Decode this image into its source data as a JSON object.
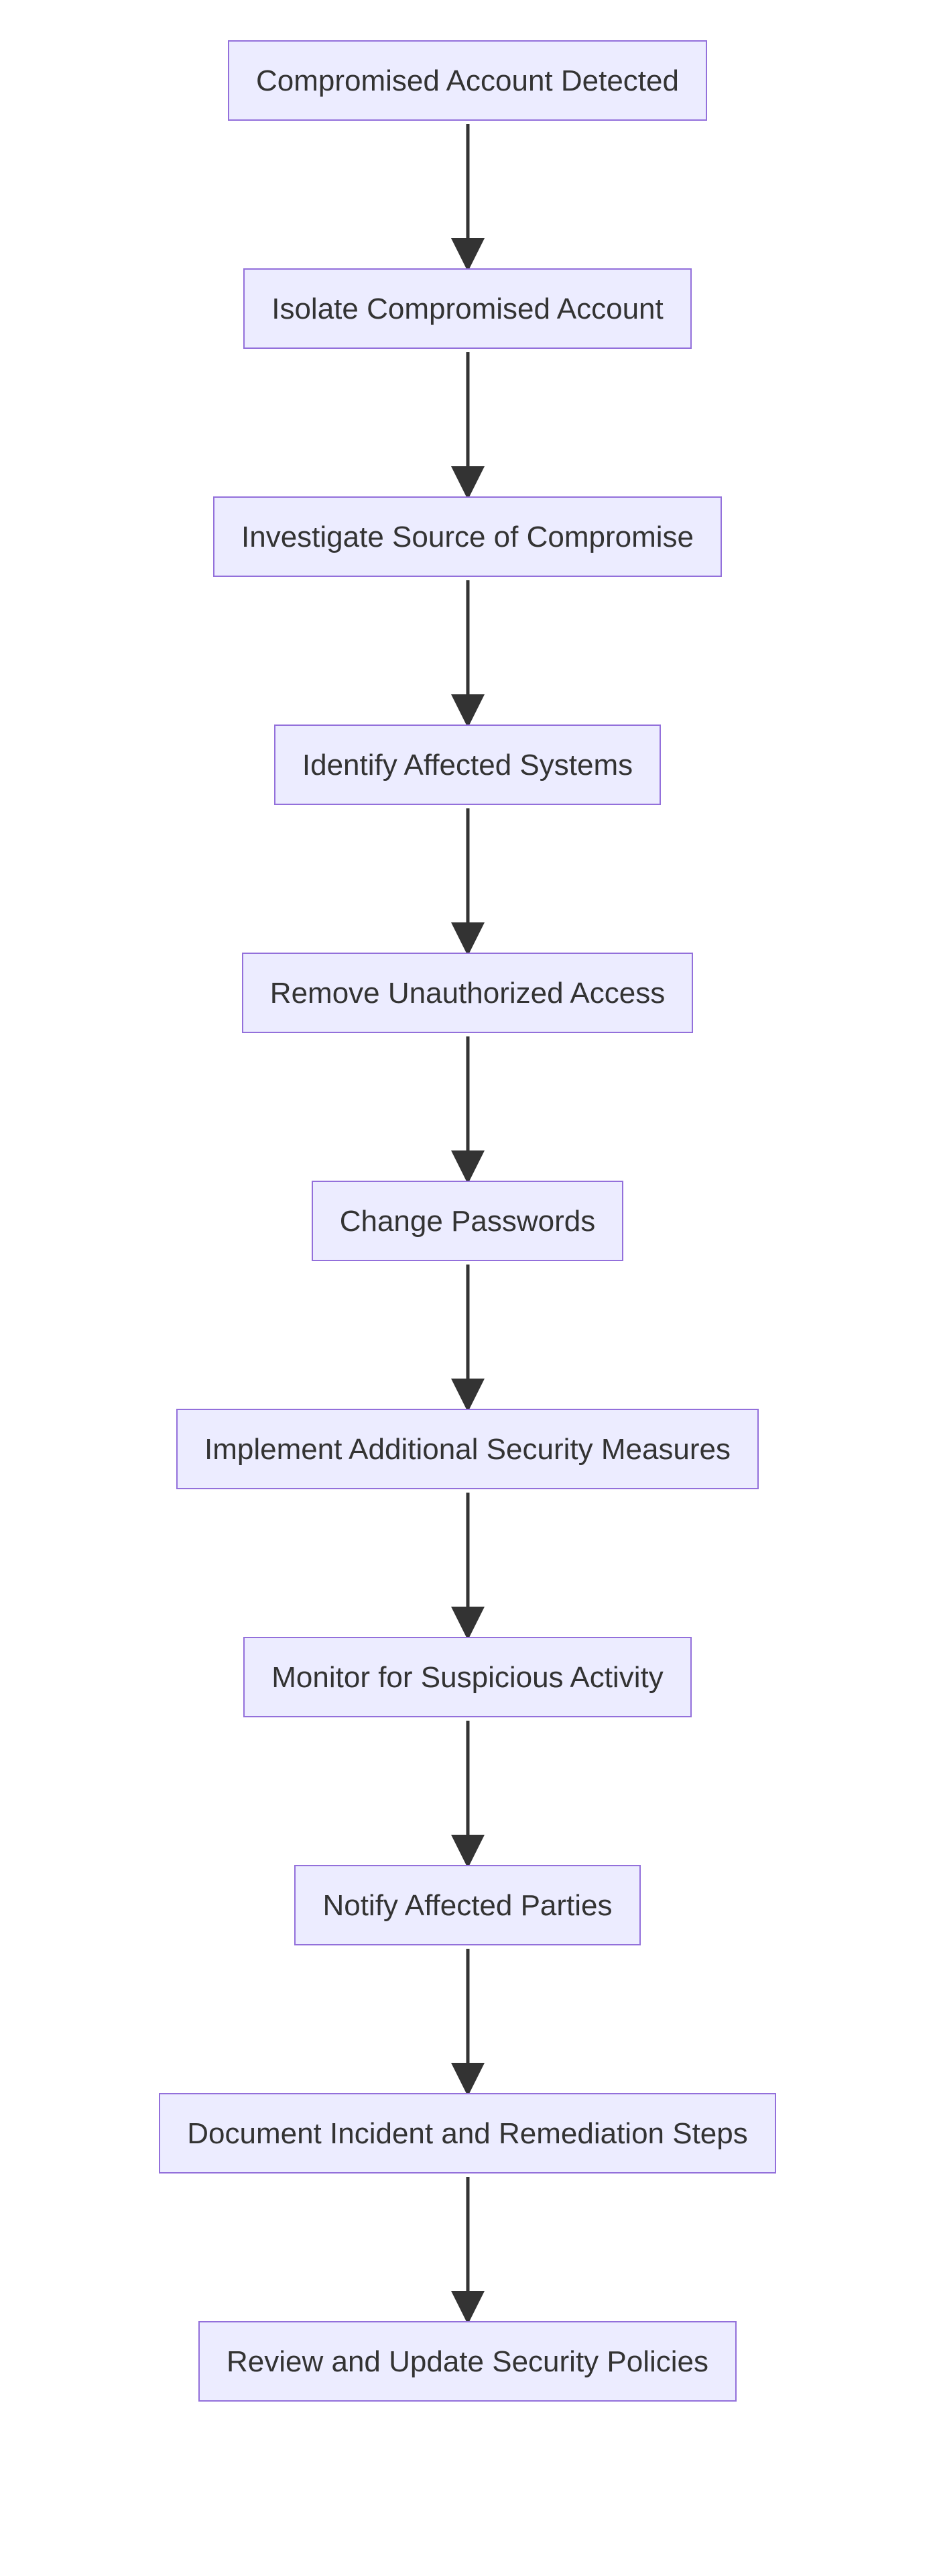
{
  "chart_data": {
    "type": "flowchart",
    "direction": "TD",
    "nodes": [
      {
        "id": "A",
        "label": "Compromised Account Detected"
      },
      {
        "id": "B",
        "label": "Isolate Compromised Account"
      },
      {
        "id": "C",
        "label": "Investigate Source of Compromise"
      },
      {
        "id": "D",
        "label": "Identify Affected Systems"
      },
      {
        "id": "E",
        "label": "Remove Unauthorized Access"
      },
      {
        "id": "F",
        "label": "Change Passwords"
      },
      {
        "id": "G",
        "label": "Implement Additional Security Measures"
      },
      {
        "id": "H",
        "label": "Monitor for Suspicious Activity"
      },
      {
        "id": "I",
        "label": "Notify Affected Parties"
      },
      {
        "id": "J",
        "label": "Document Incident and Remediation Steps"
      },
      {
        "id": "K",
        "label": "Review and Update Security Policies"
      }
    ],
    "edges": [
      {
        "from": "A",
        "to": "B"
      },
      {
        "from": "B",
        "to": "C"
      },
      {
        "from": "C",
        "to": "D"
      },
      {
        "from": "D",
        "to": "E"
      },
      {
        "from": "E",
        "to": "F"
      },
      {
        "from": "F",
        "to": "G"
      },
      {
        "from": "G",
        "to": "H"
      },
      {
        "from": "H",
        "to": "I"
      },
      {
        "from": "I",
        "to": "J"
      },
      {
        "from": "J",
        "to": "K"
      }
    ],
    "node_style": {
      "fill": "#ECECFF",
      "stroke": "#9370DB"
    },
    "edge_style": {
      "stroke": "#333333",
      "arrow": "filled"
    }
  }
}
